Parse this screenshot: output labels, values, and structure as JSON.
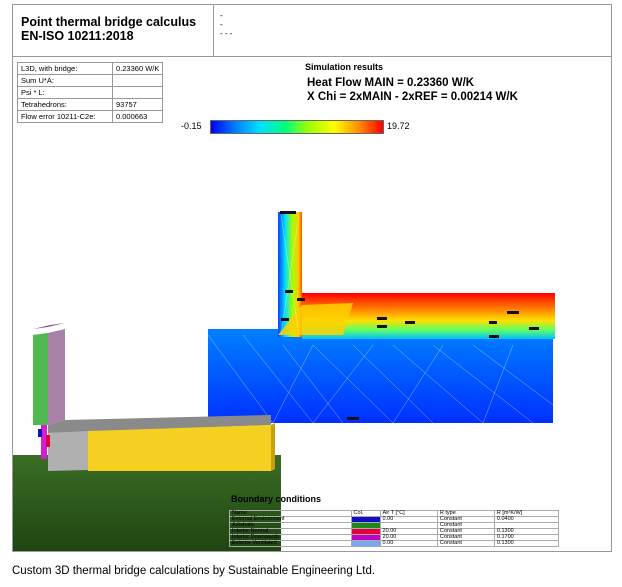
{
  "header": {
    "title_line1": "Point thermal bridge calculus",
    "title_line2": "EN-ISO 10211:2018",
    "notes": [
      "-",
      "-",
      "- - -"
    ]
  },
  "params": [
    {
      "label": "L3D, with bridge:",
      "value": "0.23360 W/K"
    },
    {
      "label": "Sum U*A:",
      "value": ""
    },
    {
      "label": "Psi * L:",
      "value": ""
    },
    {
      "label": "Tetrahedrons:",
      "value": "93757"
    },
    {
      "label": "Flow error 10211-C2e:",
      "value": "0.000663"
    }
  ],
  "results": {
    "title": "Simulation results",
    "heat_flow": "Heat Flow MAIN = 0.23360 W/K",
    "x_chi": "X Chi = 2xMAIN - 2xREF = 0.00214 W/K"
  },
  "scale": {
    "min": "-0.15",
    "max": "19.72"
  },
  "boundary": {
    "title": "Boundary conditions",
    "headers": [
      "Name",
      "Col.",
      "Air T [°C]",
      "R type",
      "R [m²K/W]"
    ],
    "rows": [
      {
        "name": "External Environment",
        "color": "#1010c0",
        "air_t": "0.00",
        "r_type": "Constant",
        "r": "0.0400"
      },
      {
        "name": "Adiabatic",
        "color": "#1e8a1e",
        "air_t": "",
        "r_type": "Constant",
        "r": ""
      },
      {
        "name": "Interior Normal",
        "color": "#e0003a",
        "air_t": "20.00",
        "r_type": "Constant",
        "r": "0.1300"
      },
      {
        "name": "Interior Downwards",
        "color": "#c000c0",
        "air_t": "20.00",
        "r_type": "Constant",
        "r": "0.1700"
      },
      {
        "name": "Exterior Ventilated",
        "color": "#7aa8f0",
        "air_t": "0.00",
        "r_type": "Constant",
        "r": "0.1300"
      }
    ]
  },
  "caption": "Custom 3D thermal bridge calculations by Sustainable Engineering Ltd.",
  "colors": {
    "hot": "#ff0000",
    "cold": "#0060ff",
    "ground": "#2d5a1e",
    "slab": "#f5d020"
  }
}
